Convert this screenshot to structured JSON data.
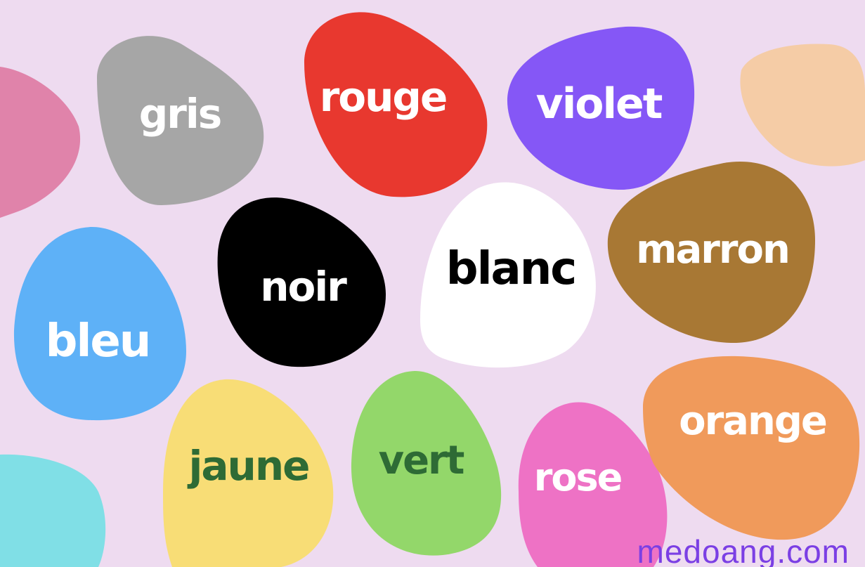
{
  "colors": {
    "background": "#EEDBF0",
    "text_white": "#FFFFFF",
    "text_black": "#000000",
    "text_green": "#2E6B35",
    "watermark": "#7B3FE4",
    "pink_edge": "#E083AA",
    "gris": "#A6A6A6",
    "rouge": "#E8382F",
    "violet": "#8557F6",
    "peach": "#F5CCA6",
    "noir": "#000000",
    "blanc": "#FFFFFF",
    "marron": "#A87834",
    "bleu": "#5EB1F7",
    "jaune": "#F8DD76",
    "vert": "#93D76A",
    "rose": "#EE72C5",
    "orange": "#F09A5B",
    "cyan_edge": "#80DFE6"
  },
  "words": {
    "gris": "gris",
    "rouge": "rouge",
    "violet": "violet",
    "noir": "noir",
    "blanc": "blanc",
    "marron": "marron",
    "bleu": "bleu",
    "jaune": "jaune",
    "vert": "vert",
    "rose": "rose",
    "orange": "orange"
  },
  "watermark": "medoang.com"
}
